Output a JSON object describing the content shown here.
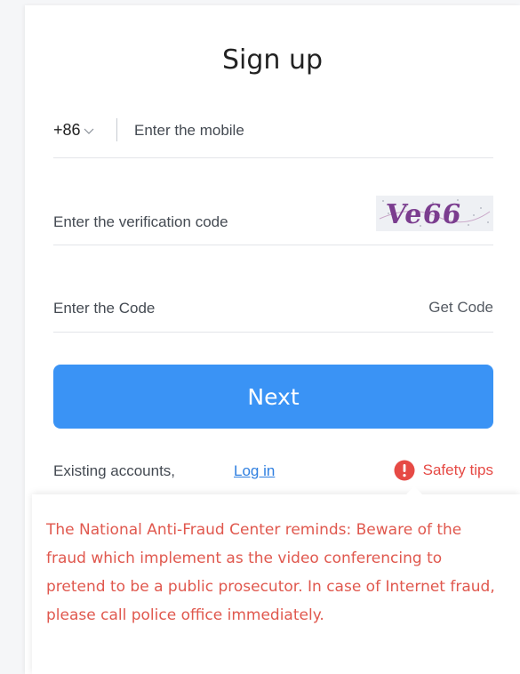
{
  "signup": {
    "title": "Sign up",
    "mobile": {
      "country_code": "+86",
      "placeholder": "Enter the mobile",
      "value": ""
    },
    "verification": {
      "placeholder": "Enter the verification code",
      "value": "",
      "captcha_text": "Ve66"
    },
    "code": {
      "placeholder": "Enter the Code",
      "value": "",
      "get_code_label": "Get Code"
    },
    "next_label": "Next",
    "existing_label": "Existing accounts,",
    "login_label": "Log in",
    "safety_label": "Safety tips",
    "safety_message": "The National Anti-Fraud Center reminds: Beware of the fraud which implement as the video conferencing to pretend to be a public prosecutor. In case of Internet fraud, please call police office immediately."
  },
  "colors": {
    "primary": "#3a93f5",
    "link": "#2f7fe0",
    "warning": "#e64a45",
    "tips_text": "#e0584e"
  },
  "icons": {
    "country_dropdown": "chevron-down-icon",
    "safety": "exclamation-circle-icon"
  }
}
